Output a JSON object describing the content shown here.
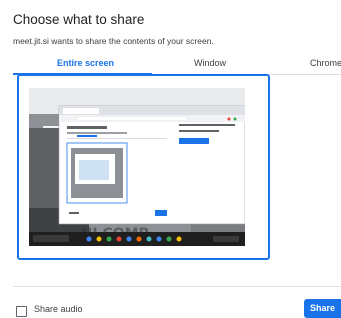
{
  "dialog": {
    "title": "Choose what to share",
    "subtitle": "meet.jit.si wants to share the contents of your screen."
  },
  "tabs": [
    {
      "label": "Entire screen",
      "active": true
    },
    {
      "label": "Window",
      "active": false
    },
    {
      "label": "Chrome",
      "active": false
    }
  ],
  "footer": {
    "share_audio_label": "Share audio",
    "share_audio_checked": false,
    "share_button": "Share"
  },
  "colors": {
    "accent": "#1a73e8",
    "selection_border": "#1a73e8"
  }
}
